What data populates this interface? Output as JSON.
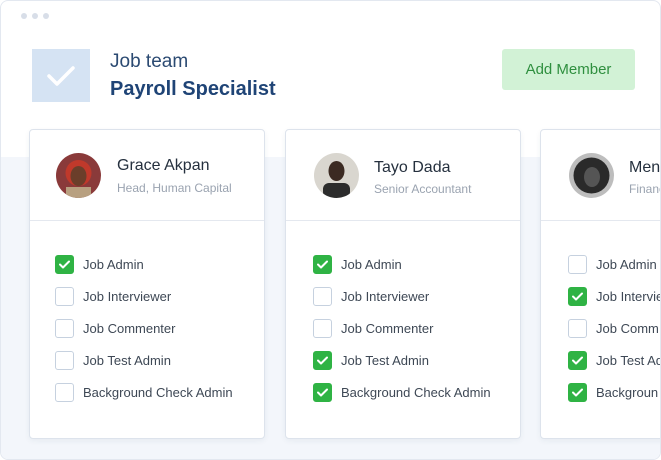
{
  "header": {
    "team_label": "Job team",
    "team_title": "Payroll Specialist",
    "add_member_label": "Add Member"
  },
  "colors": {
    "accent_green": "#2fb344",
    "button_bg": "#d2f2d6",
    "title_blue": "#1f4476",
    "logo_bg": "#d5e3f3"
  },
  "members": [
    {
      "name": "Grace Akpan",
      "role": "Head, Human Capital",
      "permissions": [
        {
          "label": "Job Admin",
          "checked": true
        },
        {
          "label": "Job Interviewer",
          "checked": false
        },
        {
          "label": "Job Commenter",
          "checked": false
        },
        {
          "label": "Job Test Admin",
          "checked": false
        },
        {
          "label": "Background Check Admin",
          "checked": false
        }
      ]
    },
    {
      "name": "Tayo Dada",
      "role": "Senior Accountant",
      "permissions": [
        {
          "label": "Job Admin",
          "checked": true
        },
        {
          "label": "Job Interviewer",
          "checked": false
        },
        {
          "label": "Job Commenter",
          "checked": false
        },
        {
          "label": "Job Test Admin",
          "checked": true
        },
        {
          "label": "Background Check Admin",
          "checked": true
        }
      ]
    },
    {
      "name": "Men",
      "role": "Financ",
      "permissions": [
        {
          "label": "Job Admin",
          "checked": false
        },
        {
          "label": "Job Intervie",
          "checked": true
        },
        {
          "label": "Job Comm",
          "checked": false
        },
        {
          "label": "Job Test Ad",
          "checked": true
        },
        {
          "label": "Backgroun",
          "checked": true
        }
      ]
    }
  ]
}
